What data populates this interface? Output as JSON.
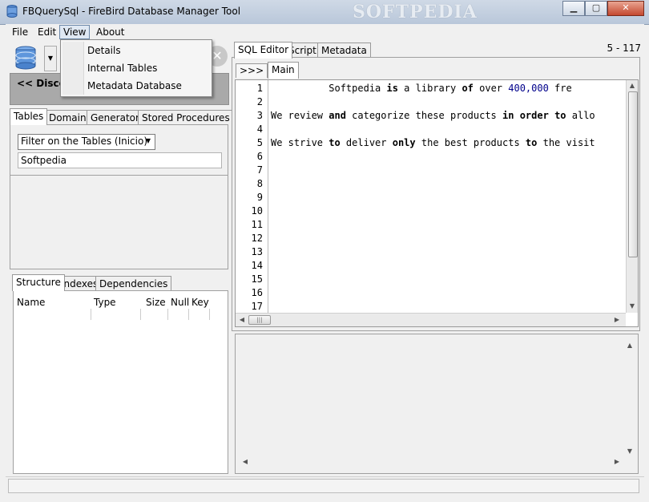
{
  "window": {
    "title": "FBQuerySql - FireBird Database Manager Tool",
    "watermark": "SOFTPEDIA",
    "minimize": "▁",
    "maximize": "▢",
    "close": "✕"
  },
  "menu": {
    "items": [
      "File",
      "Edit",
      "View",
      "About"
    ],
    "active": "View",
    "dropdown": [
      "Details",
      "Internal Tables",
      "Metadata Database"
    ]
  },
  "sidebar": {
    "disconnect_label": "<< Discon",
    "object_tabs": [
      "Tables",
      "Domains",
      "Generators",
      "Stored Procedures"
    ],
    "filter_select": "Filter on the Tables (Inicio)",
    "filter_value": "Softpedia",
    "detail_tabs": [
      "Structure",
      "Indexes",
      "Dependencies"
    ],
    "columns": [
      "Name",
      "Type",
      "Size",
      "Null",
      "Key"
    ]
  },
  "editor": {
    "tabs": [
      "SQL Editor",
      "Script",
      "Metadata"
    ],
    "position": "5 - 117",
    "expand_button": ">>>",
    "sub_tab": "Main",
    "line_numbers": [
      "1",
      "2",
      "3",
      "4",
      "5",
      "6",
      "7",
      "8",
      "9",
      "10",
      "11",
      "12",
      "13",
      "14",
      "15",
      "16",
      "17"
    ],
    "lines": {
      "l1_a": "          Softpedia ",
      "l1_b": "is",
      "l1_c": " a library ",
      "l1_d": "of",
      "l1_e": " over ",
      "l1_f": "400,000",
      "l1_g": " fre",
      "l3_a": "We review ",
      "l3_b": "and",
      "l3_c": " categorize these products ",
      "l3_d": "in",
      "l3_e": " ",
      "l3_f": "order",
      "l3_g": " ",
      "l3_h": "to",
      "l3_i": " allo",
      "l5_a": "We strive ",
      "l5_b": "to",
      "l5_c": " deliver ",
      "l5_d": "only",
      "l5_e": " the best products ",
      "l5_f": "to",
      "l5_g": " the visit"
    },
    "hscroll_grip": "|||"
  },
  "colors": {
    "number": "#00008b",
    "disconnect_bg": "#a9a9a9"
  }
}
